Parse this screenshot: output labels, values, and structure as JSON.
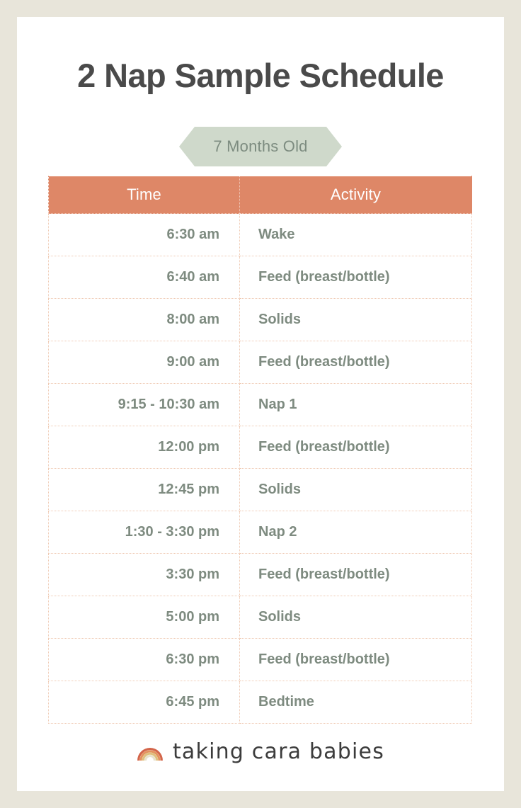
{
  "page": {
    "frame_color": "#E8E5DA",
    "card_color": "#FFFFFF"
  },
  "header": {
    "title": "2 Nap Sample Schedule",
    "badge_label": "7 Months Old",
    "title_color": "#4A4A4A",
    "badge_bg": "#CFD9CB",
    "badge_text_color": "#7D8C80"
  },
  "table": {
    "header_bg": "#DE8767",
    "header_text_color": "#FFFFFF",
    "cell_text_color": "#7E8B80",
    "border_color": "#EFC9B2",
    "columns": [
      "Time",
      "Activity"
    ],
    "rows": [
      {
        "time": "6:30 am",
        "activity": "Wake"
      },
      {
        "time": "6:40 am",
        "activity": "Feed (breast/bottle)"
      },
      {
        "time": "8:00 am",
        "activity": "Solids"
      },
      {
        "time": "9:00 am",
        "activity": "Feed (breast/bottle)"
      },
      {
        "time": "9:15 - 10:30 am",
        "activity": "Nap 1"
      },
      {
        "time": "12:00 pm",
        "activity": "Feed (breast/bottle)"
      },
      {
        "time": "12:45 pm",
        "activity": "Solids"
      },
      {
        "time": "1:30 - 3:30 pm",
        "activity": "Nap 2"
      },
      {
        "time": "3:30 pm",
        "activity": "Feed (breast/bottle)"
      },
      {
        "time": "5:00 pm",
        "activity": "Solids"
      },
      {
        "time": "6:30 pm",
        "activity": "Feed (breast/bottle)"
      },
      {
        "time": "6:45 pm",
        "activity": "Bedtime"
      }
    ]
  },
  "footer": {
    "logo_icon": "rainbow-icon",
    "logo_text": "taking cara babies",
    "logo_text_color": "#3C3C3C",
    "rainbow_colors": [
      "#D3654A",
      "#E3935F",
      "#DFC07E",
      "#E9E2CD"
    ]
  }
}
